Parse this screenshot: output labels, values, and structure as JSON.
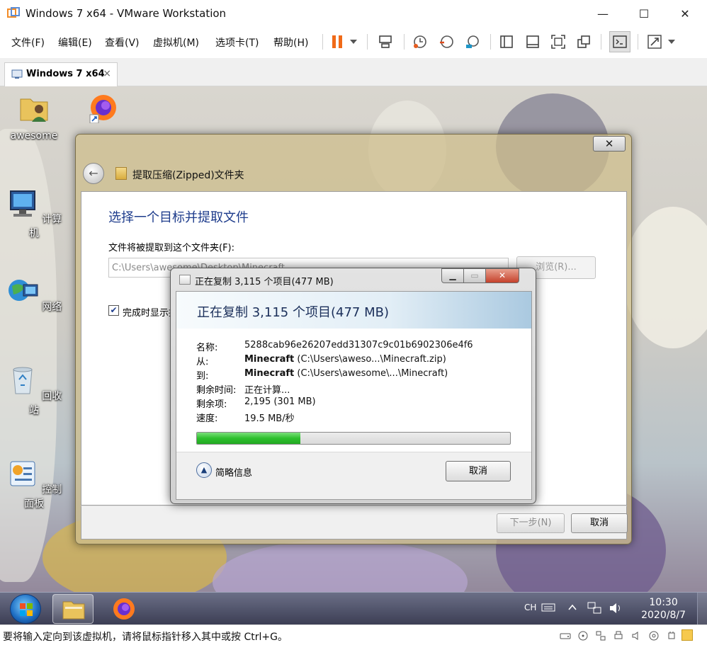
{
  "host": {
    "title": "Windows 7 x64 - VMware Workstation",
    "menu": [
      "文件(F)",
      "编辑(E)",
      "查看(V)",
      "虚拟机(M)",
      "选项卡(T)",
      "帮助(H)"
    ],
    "tab_label": "Windows 7 x64",
    "tab_close": "×",
    "window_controls": {
      "minimize": "—",
      "maximize": "☐",
      "close": "✕"
    },
    "status_message": "要将输入定向到该虚拟机，请将鼠标指针移入其中或按 Ctrl+G。",
    "toolbar_icons": [
      "pause-icon",
      "dropdown-icon",
      "send-ctrl-alt-del-icon",
      "snapshot-icon",
      "revert-snapshot-icon",
      "snapshot-manager-icon",
      "library-icon",
      "console-view-icon",
      "fullscreen-icon",
      "unity-icon",
      "terminal-icon",
      "stretch-icon"
    ]
  },
  "desktop": {
    "icons": [
      {
        "name": "awesome",
        "icon": "user-folder-icon"
      },
      {
        "name": "",
        "icon": "firefox-shortcut-icon"
      },
      {
        "name": "计算机",
        "icon": "computer-icon"
      },
      {
        "name": "网络",
        "icon": "network-icon"
      },
      {
        "name": "回收站",
        "icon": "recycle-bin-icon"
      },
      {
        "name": "控制面板",
        "icon": "control-panel-icon"
      }
    ]
  },
  "wizard": {
    "close": "✕",
    "header": "提取压缩(Zipped)文件夹",
    "heading": "选择一个目标并提取文件",
    "path_label": "文件将被提取到这个文件夹(F):",
    "path_value": "C:\\Users\\awesome\\Desktop\\Minecraft",
    "browse": "浏览(R)...",
    "show_checkbox_label": "完成时显示提取的文件(H)",
    "show_checkbox_checked": true,
    "next": "下一步(N)",
    "cancel": "取消"
  },
  "copy_dialog": {
    "title": "正在复制 3,115 个项目(477 MB)",
    "banner_title": "正在复制 3,115 个项目(477 MB)",
    "rows": [
      {
        "label": "名称:",
        "value": "5288cab96e26207edd31307c9c01b6902306e4f6",
        "bold": ""
      },
      {
        "label": "从:",
        "bold": "Minecraft",
        "value": " (C:\\Users\\aweso...\\Minecraft.zip)"
      },
      {
        "label": "到:",
        "bold": "Minecraft",
        "value": " (C:\\Users\\awesome\\...\\Minecraft)"
      },
      {
        "label": "剩余时间:",
        "value": "正在计算...",
        "bold": ""
      },
      {
        "label": "剩余项:",
        "value": "2,195 (301 MB)",
        "bold": ""
      },
      {
        "label": "速度:",
        "value": "19.5 MB/秒",
        "bold": ""
      }
    ],
    "progress_percent": 33,
    "details_toggle": "简略信息",
    "cancel": "取消",
    "buttons": {
      "minimize": "▁",
      "maximize": "▭",
      "close": "✕"
    }
  },
  "taskbar": {
    "ime": "CH",
    "clock_time": "10:30",
    "clock_date": "2020/8/7",
    "colors": {
      "accent": "#1e3c8c",
      "progress": "#2ec02e"
    }
  }
}
